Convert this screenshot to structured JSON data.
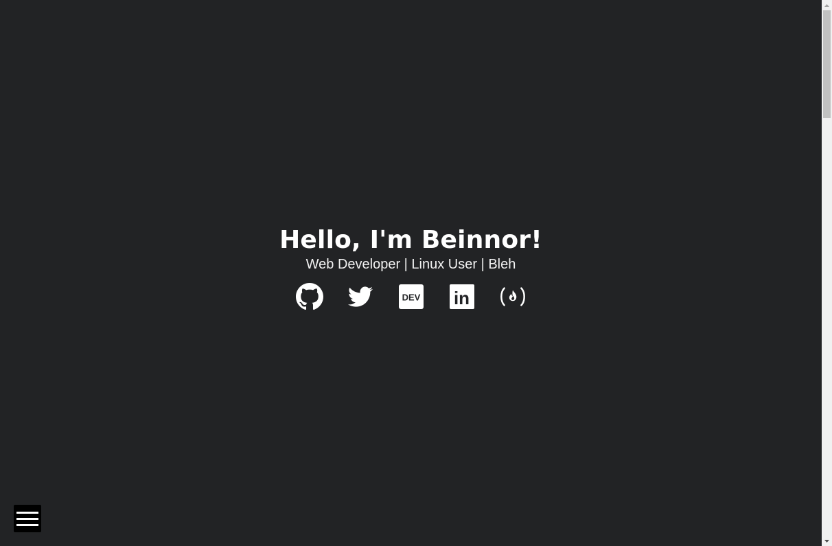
{
  "hero": {
    "title": "Hello, I'm Beinnor!",
    "subtitle": "Web Developer | Linux User | Bleh"
  },
  "social_links": [
    {
      "name": "GitHub",
      "icon": "github-icon"
    },
    {
      "name": "Twitter",
      "icon": "twitter-icon"
    },
    {
      "name": "DEV",
      "icon": "dev-icon",
      "label": "DEV"
    },
    {
      "name": "LinkedIn",
      "icon": "linkedin-icon",
      "label": "in"
    },
    {
      "name": "freeCodeCamp",
      "icon": "freecodecamp-icon"
    }
  ],
  "menu": {
    "icon": "hamburger-menu-icon"
  },
  "colors": {
    "background": "#222325",
    "text": "#ffffff",
    "menu_button": "#000000",
    "scrollbar_track": "#f1f1f1",
    "scrollbar_thumb": "#c1c1c1"
  }
}
